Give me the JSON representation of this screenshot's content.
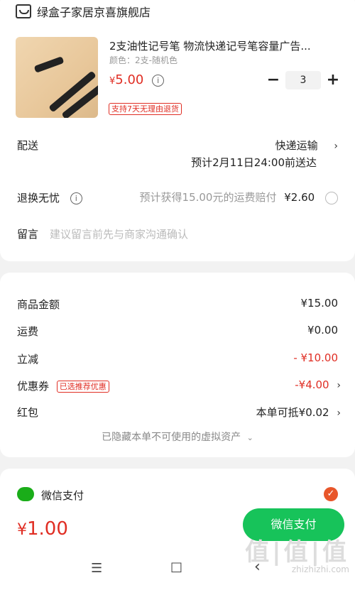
{
  "store": {
    "name": "绿盒子家居京喜旗舰店"
  },
  "product": {
    "title": "2支油性记号笔 物流快递记号笔容量广告...",
    "variant": "颜色：2支-随机色",
    "price_symbol": "¥",
    "price": "5.00",
    "quantity": "3",
    "minus": "−",
    "plus": "+",
    "return_badge": "支持7天无理由退货"
  },
  "delivery": {
    "label": "配送",
    "method": "快递运输",
    "eta": "预计2月11日24:00前送达"
  },
  "return_worry": {
    "label": "退换无忧",
    "desc": "预计获得15.00元的运费赔付",
    "price": "¥2.60"
  },
  "message": {
    "label": "留言",
    "placeholder": "建议留言前先与商家沟通确认"
  },
  "summary": {
    "goods_label": "商品金额",
    "goods_value": "¥15.00",
    "shipping_label": "运费",
    "shipping_value": "¥0.00",
    "discount_label": "立减",
    "discount_value": "- ¥10.00",
    "coupon_label": "优惠券",
    "coupon_badge": "已选推荐优惠",
    "coupon_value": "-¥4.00",
    "redpacket_label": "红包",
    "redpacket_value": "本单可抵¥0.02",
    "hidden_assets": "已隐藏本单不可使用的虚拟资产"
  },
  "payment": {
    "method_label": "微信支付",
    "check": "✓"
  },
  "bottom": {
    "total_symbol": "¥",
    "total": "1.00",
    "pay_button": "微信支付"
  },
  "nav": {
    "menu": "☰",
    "home": "□",
    "back": "‹"
  },
  "watermark": {
    "big": "值|值|值",
    "small": "zhizhizhi.com"
  },
  "colors": {
    "accent": "#e02e24",
    "wechat": "#17c35a",
    "check": "#e8562a"
  }
}
